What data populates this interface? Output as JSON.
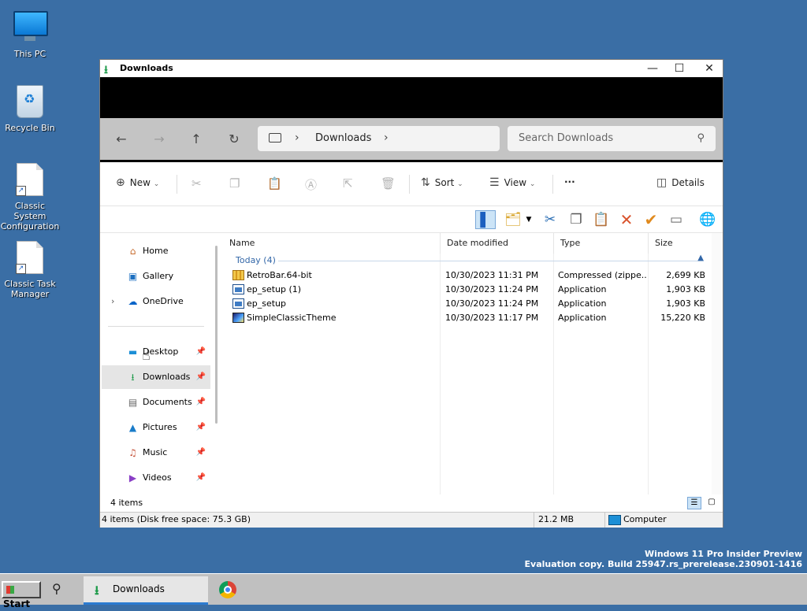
{
  "desktop": {
    "icons": [
      {
        "label": "This PC",
        "icon": "monitor-icon"
      },
      {
        "label": "Recycle Bin",
        "icon": "recycle-bin-icon"
      },
      {
        "label": "Classic System Configuration",
        "icon": "document-shortcut-icon"
      },
      {
        "label": "Classic Task Manager",
        "icon": "document-shortcut-icon"
      }
    ],
    "watermark_line1": "Windows 11 Pro Insider Preview",
    "watermark_line2": "Evaluation copy. Build 25947.rs_prerelease.230901-1416"
  },
  "window": {
    "title": "Downloads",
    "controls": {
      "minimize": "—",
      "maximize": "☐",
      "close": "✕"
    },
    "address": {
      "location": "Downloads"
    },
    "search": {
      "placeholder": "Search Downloads"
    },
    "commands": {
      "new": "New",
      "sort": "Sort",
      "view": "View",
      "more": "···",
      "details": "Details"
    },
    "nav": {
      "items": [
        {
          "label": "Home",
          "icon": "home-icon"
        },
        {
          "label": "Gallery",
          "icon": "gallery-icon"
        },
        {
          "label": "OneDrive",
          "icon": "cloud-icon"
        },
        {
          "label": "Desktop",
          "icon": "desktop-icon",
          "pinned": true
        },
        {
          "label": "Downloads",
          "icon": "download-icon",
          "pinned": true,
          "selected": true
        },
        {
          "label": "Documents",
          "icon": "documents-icon",
          "pinned": true
        },
        {
          "label": "Pictures",
          "icon": "pictures-icon",
          "pinned": true
        },
        {
          "label": "Music",
          "icon": "music-icon",
          "pinned": true
        },
        {
          "label": "Videos",
          "icon": "videos-icon",
          "pinned": true
        }
      ]
    },
    "columns": {
      "name": "Name",
      "date": "Date modified",
      "type": "Type",
      "size": "Size"
    },
    "group": {
      "label": "Today (4)"
    },
    "files": [
      {
        "name": "RetroBar.64-bit",
        "date": "10/30/2023 11:31 PM",
        "type": "Compressed (zippe...",
        "size": "2,699 KB",
        "icon": "zip-icon"
      },
      {
        "name": "ep_setup (1)",
        "date": "10/30/2023 11:24 PM",
        "type": "Application",
        "size": "1,903 KB",
        "icon": "application-icon"
      },
      {
        "name": "ep_setup",
        "date": "10/30/2023 11:24 PM",
        "type": "Application",
        "size": "1,903 KB",
        "icon": "application-icon"
      },
      {
        "name": "SimpleClassicTheme",
        "date": "10/30/2023 11:17 PM",
        "type": "Application",
        "size": "15,220 KB",
        "icon": "theme-app-icon"
      }
    ],
    "status": {
      "count": "4 items"
    },
    "classic_status": {
      "info": "4 items (Disk free space: 75.3 GB)",
      "size": "21.2 MB",
      "zone": "Computer"
    }
  },
  "taskbar": {
    "start": "Start",
    "task_label": "Downloads"
  },
  "colors": {
    "desktop": "#3a6ea5",
    "accent": "#2c7bd0"
  }
}
